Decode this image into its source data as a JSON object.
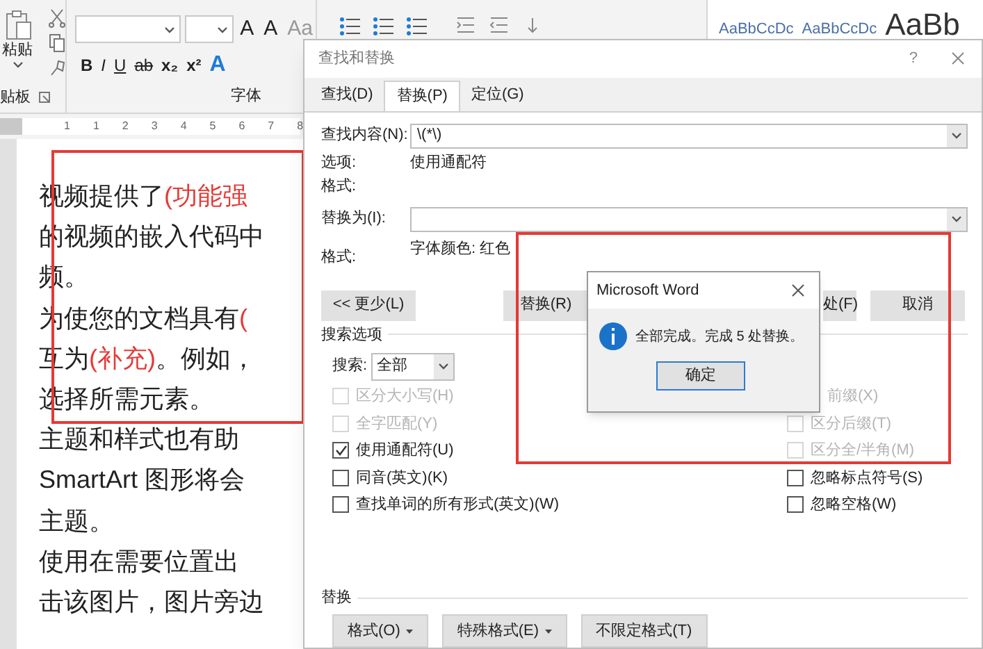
{
  "ribbon": {
    "paste_label": "粘贴",
    "clipboard_label": "贴板",
    "font_label": "字体",
    "font_tools": [
      {
        "text": "B",
        "kind": "bold"
      },
      {
        "text": "I",
        "kind": "italic"
      },
      {
        "text": "U",
        "kind": "underline"
      },
      {
        "text": "ab",
        "kind": "strike"
      },
      {
        "text": "x₂",
        "kind": "sub"
      },
      {
        "text": "x²",
        "kind": "sup"
      },
      {
        "text": "A",
        "kind": "effect"
      }
    ],
    "size_tools": [
      "A",
      "A",
      "Aa"
    ],
    "styles": [
      {
        "text": "AaBbCcDc",
        "large": false
      },
      {
        "text": "AaBbCcDc",
        "large": false
      },
      {
        "text": "AaBb",
        "large": true
      }
    ]
  },
  "ruler": {
    "numbers": [
      "1",
      "1",
      "2",
      "3",
      "4",
      "5",
      "6",
      "7",
      "8"
    ]
  },
  "document": {
    "lines": [
      [
        {
          "text": "视频提供了",
          "highlighted": false
        },
        {
          "text": "(功能强",
          "highlighted": true
        }
      ],
      [
        {
          "text": "的视频的嵌入代码中",
          "highlighted": false
        }
      ],
      [
        {
          "text": "频。",
          "highlighted": false
        }
      ],
      [
        {
          "text": "为使您的文档具有",
          "highlighted": false
        },
        {
          "text": "(",
          "highlighted": true
        }
      ],
      [
        {
          "text": "互为",
          "highlighted": false
        },
        {
          "text": "(补充)",
          "highlighted": true
        },
        {
          "text": "。例如，",
          "highlighted": false
        }
      ],
      [
        {
          "text": "选择所需元素。",
          "highlighted": false
        }
      ],
      [
        {
          "text": "主题和样式也有助",
          "highlighted": false
        }
      ],
      [
        {
          "text": "SmartArt 图形将会",
          "highlighted": false
        }
      ],
      [
        {
          "text": "主题。",
          "highlighted": false
        }
      ],
      [
        {
          "text": "使用在需要位置出",
          "highlighted": false
        }
      ],
      [
        {
          "text": "击该图片，图片旁边",
          "highlighted": false
        }
      ]
    ]
  },
  "dialog": {
    "title": "查找和替换",
    "help": "?",
    "tabs": [
      {
        "label": "查找(D)",
        "selected": false
      },
      {
        "label": "替换(P)",
        "selected": true
      },
      {
        "label": "定位(G)",
        "selected": false
      }
    ],
    "find": {
      "label": "查找内容(N):",
      "value": "\\(*\\)"
    },
    "options_label": "选项:",
    "options_value": "使用通配符",
    "find_format_label": "格式:",
    "replace": {
      "label": "替换为(I):"
    },
    "replace_format_label": "格式:",
    "replace_format_value": "字体颜色: 红色",
    "buttons": [
      {
        "label": "<< 更少(L)",
        "kind": "more"
      },
      {
        "label": "替换(R)",
        "kind": "replace"
      },
      {
        "label": "处(F)",
        "kind": "next"
      },
      {
        "label": "取消",
        "kind": "cancel"
      }
    ],
    "search_options": {
      "title": "搜索选项",
      "search_label": "搜索:",
      "search_value": "全部",
      "left": [
        {
          "label": "区分大小写(H)",
          "checked": false,
          "disabled": true
        },
        {
          "label": "全字匹配(Y)",
          "checked": false,
          "disabled": true
        },
        {
          "label": "使用通配符(U)",
          "checked": true,
          "disabled": false
        },
        {
          "label": "同音(英文)(K)",
          "checked": false,
          "disabled": false
        },
        {
          "label": "查找单词的所有形式(英文)(W)",
          "checked": false,
          "disabled": false
        }
      ],
      "right": [
        {
          "label": "前缀(X)",
          "disabled": true
        },
        {
          "label": "区分后缀(T)",
          "checked": false,
          "disabled": true
        },
        {
          "label": "区分全/半角(M)",
          "checked": false,
          "disabled": true
        },
        {
          "label": "忽略标点符号(S)",
          "checked": false,
          "disabled": false
        },
        {
          "label": "忽略空格(W)",
          "checked": false,
          "disabled": false
        }
      ]
    },
    "replace_section": {
      "title": "替换",
      "buttons": [
        {
          "label": "格式(O)",
          "dropdown": true
        },
        {
          "label": "特殊格式(E)",
          "dropdown": true
        },
        {
          "label": "不限定格式(T)",
          "dropdown": false
        }
      ]
    }
  },
  "message_box": {
    "title": "Microsoft Word",
    "message": "全部完成。完成 5 处替换。",
    "button": "确定"
  }
}
